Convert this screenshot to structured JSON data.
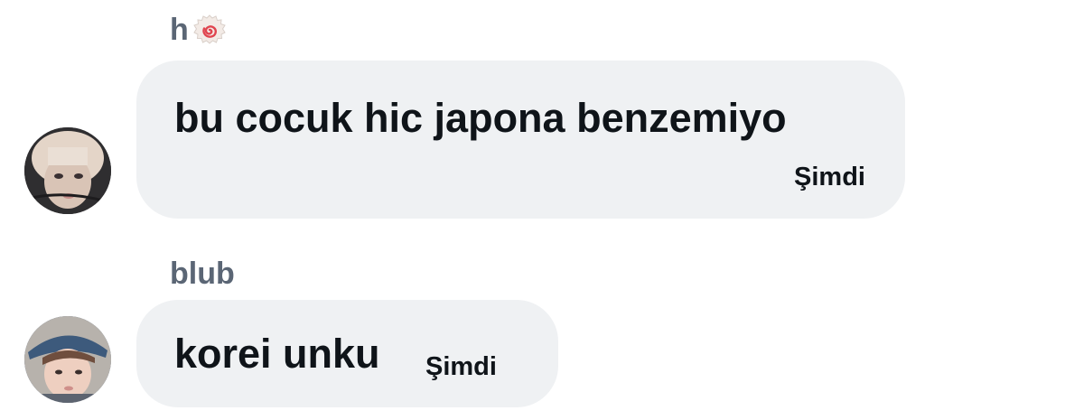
{
  "messages": [
    {
      "sender": "h",
      "sender_icon": "naruto-icon",
      "text": "bu cocuk hic japona benzemiyo",
      "time": "Şimdi"
    },
    {
      "sender": "blub",
      "text": "korei unku",
      "time": "Şimdi"
    }
  ],
  "colors": {
    "bubble": "#eff1f3",
    "text": "#0f1419",
    "sender": "#5b6675"
  }
}
